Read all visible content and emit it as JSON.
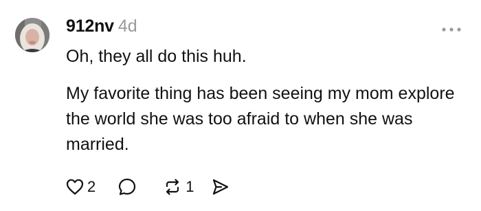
{
  "post": {
    "username": "912nv",
    "time_ago": "4d",
    "paragraphs": [
      "Oh, they all do this huh.",
      "My favorite thing has been seeing my mom explore the world she was too afraid to when she was married."
    ],
    "actions": {
      "like_count": "2",
      "repost_count": "1"
    }
  },
  "icons": {
    "more": "more-dots-icon",
    "like": "heart-icon",
    "reply": "comment-bubble-icon",
    "repost": "repost-icon",
    "share": "send-icon"
  },
  "colors": {
    "text": "#111111",
    "muted": "#9a9a9a",
    "background": "#ffffff"
  }
}
